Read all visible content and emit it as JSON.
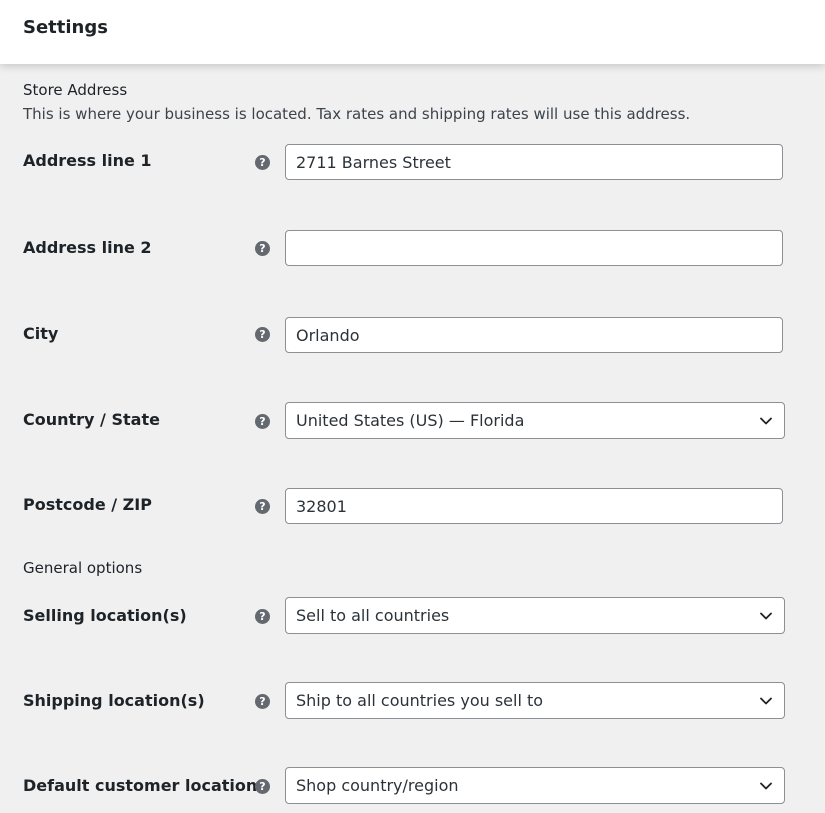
{
  "header": {
    "title": "Settings"
  },
  "store_address": {
    "title": "Store Address",
    "description": "This is where your business is located. Tax rates and shipping rates will use this address.",
    "fields": {
      "address_line_1": {
        "label": "Address line 1",
        "value": "2711 Barnes Street"
      },
      "address_line_2": {
        "label": "Address line 2",
        "value": ""
      },
      "city": {
        "label": "City",
        "value": "Orlando"
      },
      "country_state": {
        "label": "Country / State",
        "value": "United States (US) — Florida"
      },
      "postcode": {
        "label": "Postcode / ZIP",
        "value": "32801"
      }
    }
  },
  "general_options": {
    "title": "General options",
    "fields": {
      "selling_locations": {
        "label": "Selling location(s)",
        "value": "Sell to all countries"
      },
      "shipping_locations": {
        "label": "Shipping location(s)",
        "value": "Ship to all countries you sell to"
      },
      "default_customer_location": {
        "label": "Default customer location",
        "value": "Shop country/region"
      }
    }
  },
  "help_icon_glyph": "?",
  "icons": {
    "help": "help-circle-icon",
    "dropdown": "chevron-down-icon"
  },
  "colors": {
    "background": "#f0f0f1",
    "input_border": "#8c8f94",
    "help_icon": "#646970",
    "text": "#1d2327"
  }
}
